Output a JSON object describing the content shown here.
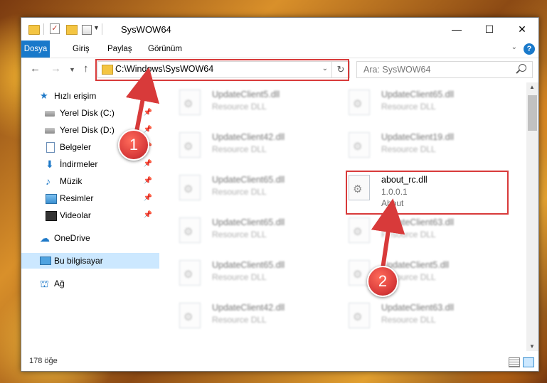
{
  "window": {
    "title": "SysWOW64",
    "minimize_glyph": "—",
    "maximize_glyph": "☐",
    "close_glyph": "✕"
  },
  "ribbon": {
    "tabs": [
      "Dosya",
      "Giriş",
      "Paylaş",
      "Görünüm"
    ],
    "help": "?"
  },
  "navigation": {
    "address": "C:\\Windows\\SysWOW64",
    "search_placeholder": "Ara: SysWOW64"
  },
  "sidebar": {
    "quick_access": "Hızlı erişim",
    "items": [
      {
        "label": "Yerel Disk (C:)",
        "icon": "disk-icon",
        "pinned": true
      },
      {
        "label": "Yerel Disk (D:)",
        "icon": "disk-icon",
        "pinned": true
      },
      {
        "label": "Belgeler",
        "icon": "documents-icon",
        "pinned": true
      },
      {
        "label": "İndirmeler",
        "icon": "download-icon",
        "pinned": true
      },
      {
        "label": "Müzik",
        "icon": "music-icon",
        "pinned": true
      },
      {
        "label": "Resimler",
        "icon": "pictures-icon",
        "pinned": true
      },
      {
        "label": "Videolar",
        "icon": "videos-icon",
        "pinned": true
      }
    ],
    "onedrive": "OneDrive",
    "this_pc": "Bu bilgisayar",
    "network": "Ağ"
  },
  "files": {
    "left_column": [
      {
        "name": "UpdateClient5.dll",
        "desc": "Resource DLL"
      },
      {
        "name": "UpdateClient42.dll",
        "desc": "Resource DLL"
      },
      {
        "name": "UpdateClient65.dll",
        "desc": "Resource DLL"
      },
      {
        "name": "UpdateClient65.dll",
        "desc": "Resource DLL"
      },
      {
        "name": "UpdateClient65.dll",
        "desc": "Resource DLL"
      },
      {
        "name": "UpdateClient42.dll",
        "desc": "Resource DLL"
      }
    ],
    "right_column": [
      {
        "name": "UpdateClient65.dll",
        "desc": "Resource DLL"
      },
      {
        "name": "UpdateClient19.dll",
        "desc": "Resource DLL"
      },
      {
        "name": "about_rc.dll",
        "version": "1.0.0.1",
        "desc": "About",
        "highlighted": true
      },
      {
        "name": "UpdateClient63.dll",
        "desc": "Resource DLL"
      },
      {
        "name": "UpdateClient5.dll",
        "desc": "Resource DLL"
      },
      {
        "name": "UpdateClient63.dll",
        "desc": "Resource DLL"
      }
    ]
  },
  "status": {
    "item_count": "178 öğe"
  },
  "annotations": {
    "step1": "1",
    "step2": "2",
    "color": "#d83a3a"
  }
}
